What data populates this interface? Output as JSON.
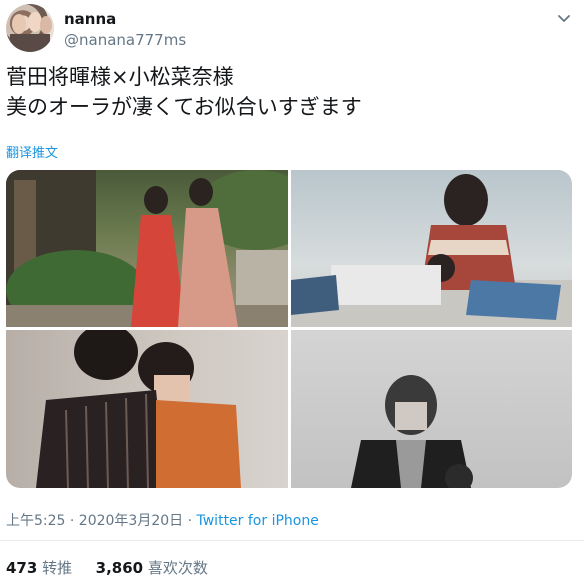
{
  "user": {
    "name": "nanna",
    "handle": "@nanana777ms"
  },
  "tweet": {
    "line1": "菅田将暉様×小松菜奈様",
    "line2": "美のオーラが凄くてお似合いすぎます",
    "translate": "翻译推文"
  },
  "meta": {
    "time": "上午5:25 · 2020年3月20日 · ",
    "source": "Twitter for iPhone"
  },
  "stats": {
    "retweets_count": "473",
    "retweets_label": "转推",
    "likes_count": "3,860",
    "likes_label": "喜欢次数"
  },
  "icons": {
    "menu": "chevron-down-icon"
  }
}
